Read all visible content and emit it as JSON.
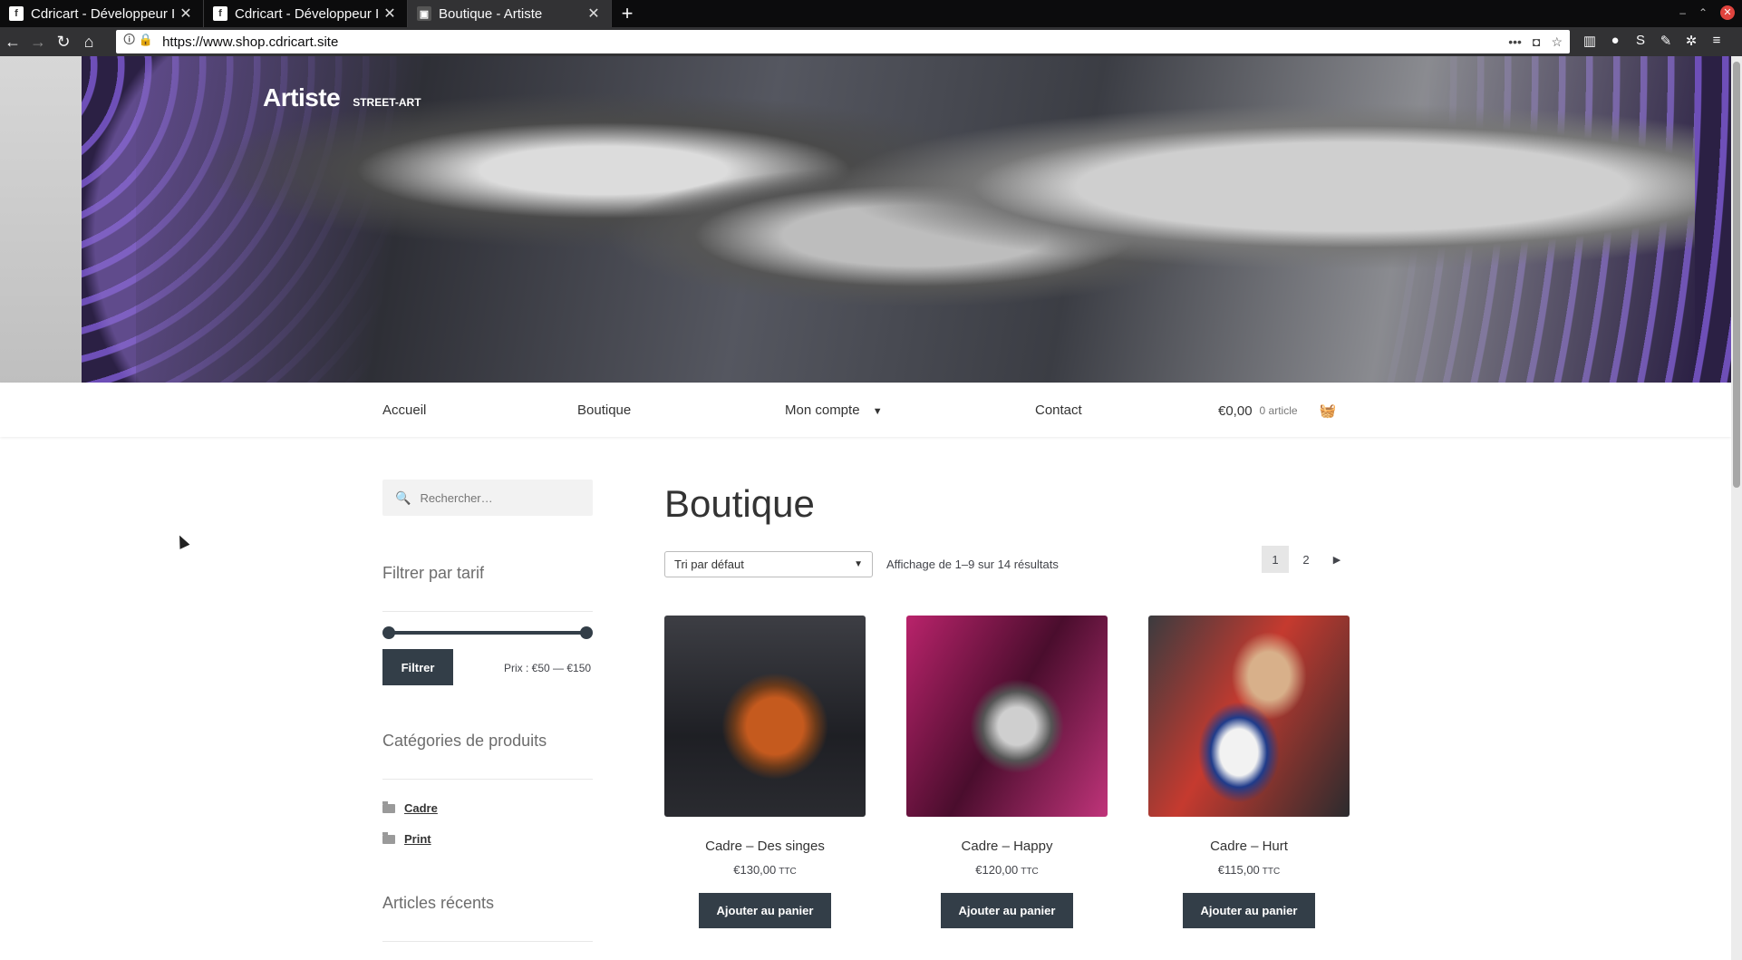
{
  "browser": {
    "tabs": [
      {
        "title": "Cdricart - Développeur I",
        "active": false
      },
      {
        "title": "Cdricart - Développeur I",
        "active": false
      },
      {
        "title": "Boutique - Artiste",
        "active": true
      }
    ],
    "url": "https://www.shop.cdricart.site"
  },
  "site": {
    "name": "Artiste",
    "tagline": "STREET-ART"
  },
  "nav": {
    "items": [
      "Accueil",
      "Boutique",
      "Mon compte",
      "Contact"
    ],
    "cart_total": "€0,00",
    "cart_count": "0 article"
  },
  "sidebar": {
    "search_placeholder": "Rechercher…",
    "price_filter_title": "Filtrer par tarif",
    "filter_button": "Filtrer",
    "price_label": "Prix : €50 — €150",
    "categories_title": "Catégories de produits",
    "categories": [
      "Cadre",
      "Print"
    ],
    "recent_title": "Articles récents"
  },
  "main": {
    "title": "Boutique",
    "sort_value": "Tri par défaut",
    "result_count": "Affichage de 1–9 sur 14 résultats",
    "pages": [
      "1",
      "2"
    ],
    "products": [
      {
        "name": "Cadre – Des singes",
        "price": "€130,00",
        "ttc": "TTC",
        "button": "Ajouter au panier"
      },
      {
        "name": "Cadre – Happy",
        "price": "€120,00",
        "ttc": "TTC",
        "button": "Ajouter au panier"
      },
      {
        "name": "Cadre – Hurt",
        "price": "€115,00",
        "ttc": "TTC",
        "button": "Ajouter au panier"
      }
    ]
  },
  "colors": {
    "button_bg": "#333e48",
    "chrome_dark": "#0c0c0d"
  }
}
